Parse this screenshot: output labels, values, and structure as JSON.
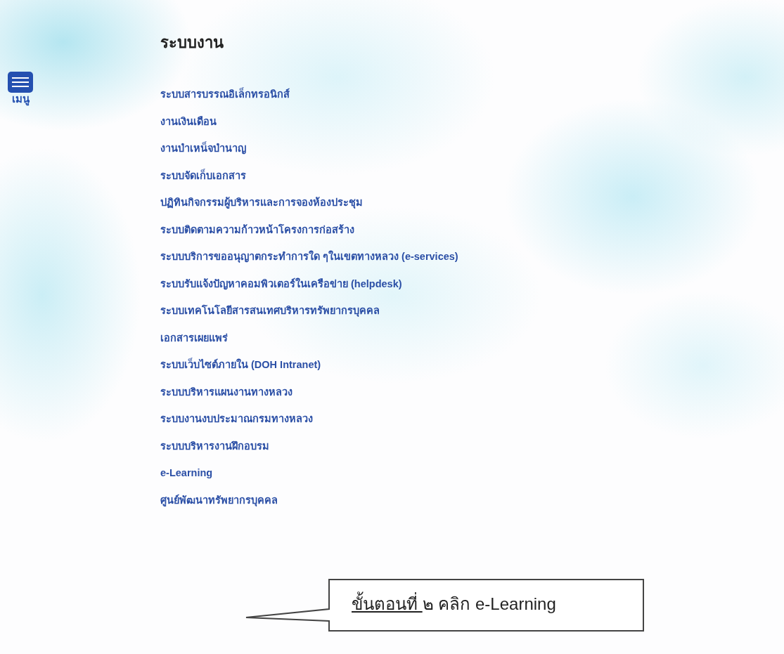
{
  "menu_button": {
    "label": "เมนู"
  },
  "section": {
    "title": "ระบบงาน",
    "links": [
      {
        "label": "ระบบสารบรรณอิเล็กทรอนิกส์"
      },
      {
        "label": "งานเงินเดือน"
      },
      {
        "label": "งานบำเหน็จบำนาญ"
      },
      {
        "label": "ระบบจัดเก็บเอกสาร"
      },
      {
        "label": "ปฏิทินกิจกรรมผู้บริหารและการจองห้องประชุม"
      },
      {
        "label": "ระบบติดตามความก้าวหน้าโครงการก่อสร้าง"
      },
      {
        "label": "ระบบบริการขออนุญาตกระทำการใด ๆในเขตทางหลวง (e-services)"
      },
      {
        "label": "ระบบรับแจ้งปัญหาคอมพิวเตอร์ในเครือข่าย (helpdesk)"
      },
      {
        "label": "ระบบเทคโนโลยีสารสนเทศบริหารทรัพยากรบุคคล"
      },
      {
        "label": "เอกสารเผยแพร่"
      },
      {
        "label": "ระบบเว็บไซต์ภายใน (DOH Intranet)"
      },
      {
        "label": "ระบบบริหารแผนงานทางหลวง"
      },
      {
        "label": "ระบบงานงบประมาณกรมทางหลวง"
      },
      {
        "label": "ระบบบริหารงานฝึกอบรม"
      },
      {
        "label": "e-Learning"
      },
      {
        "label": "ศูนย์พัฒนาทรัพยากรบุคคล"
      }
    ]
  },
  "callout": {
    "step_label": "ขั้นตอนที่",
    "text": "๒  คลิก e-Learning"
  }
}
